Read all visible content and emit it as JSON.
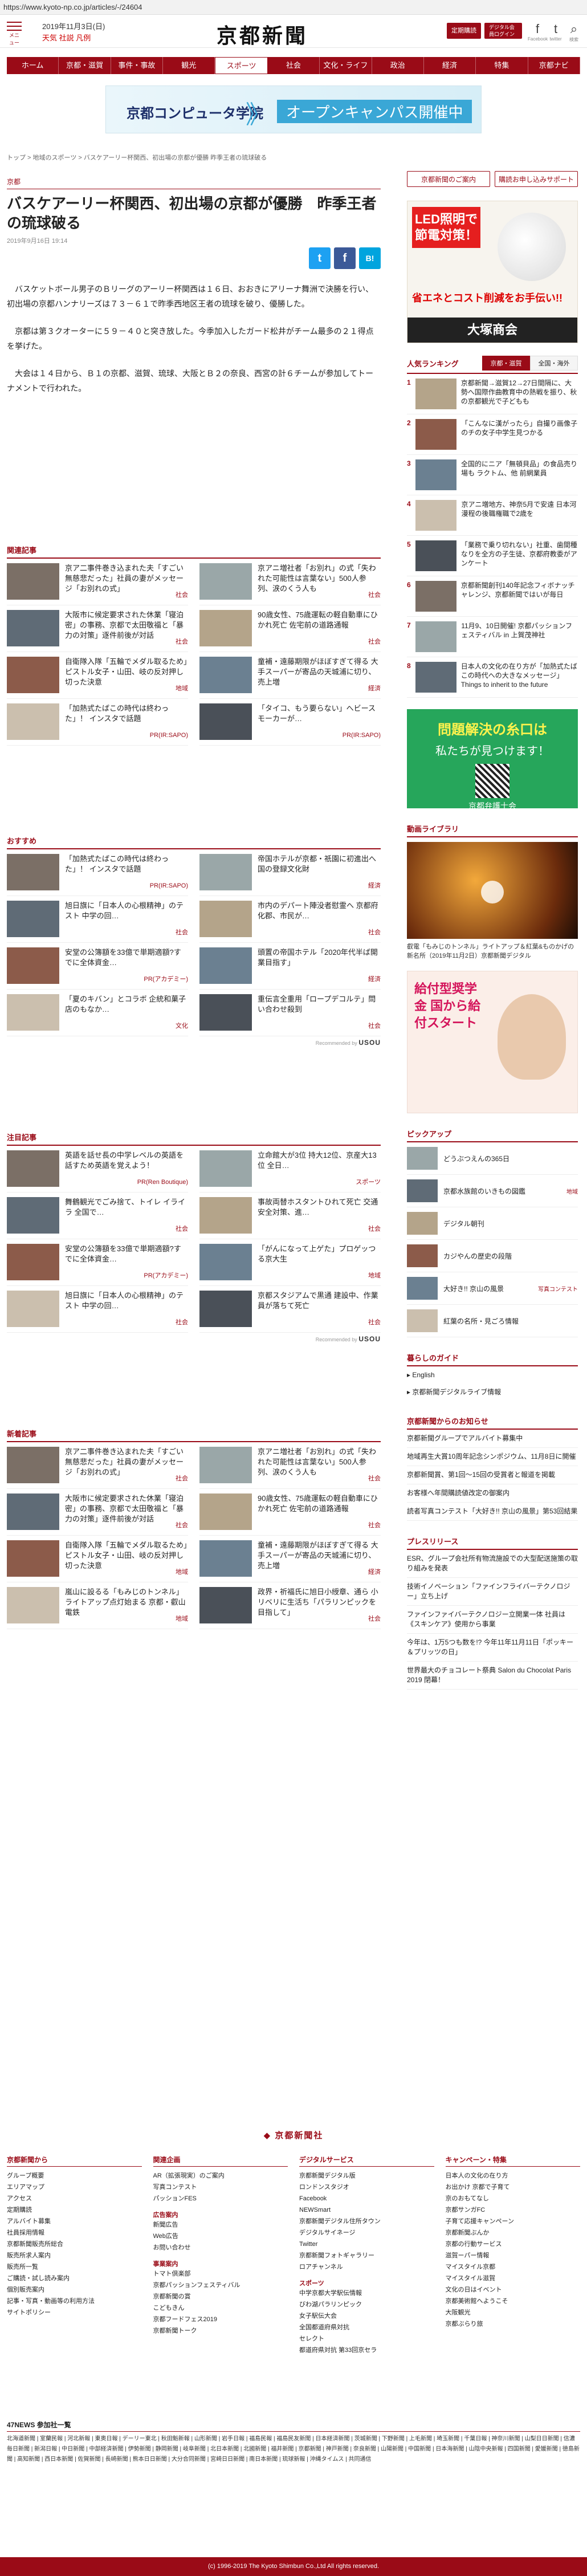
{
  "browser": {
    "url": "https://www.kyoto-np.co.jp/articles/-/24604"
  },
  "header": {
    "menu_label": "メニュー",
    "date": "2019年11月3日(日)",
    "weather": "天気  社説  凡例",
    "logo": "京都新聞",
    "btn_plan": "定期購読",
    "btn_login": "デジタル会員ログイン",
    "sns": [
      {
        "icon": "facebook-icon",
        "glyph": "f",
        "label": "Facebook"
      },
      {
        "icon": "twitter-icon",
        "glyph": "t",
        "label": "twitter"
      },
      {
        "icon": "search-icon",
        "glyph": "⌕",
        "label": "検索"
      }
    ]
  },
  "nav": [
    "ホーム",
    "京都・滋賀",
    "事件・事故",
    "観光",
    "スポーツ",
    "社会",
    "文化・ライフ",
    "政治",
    "経済",
    "特集",
    "京都ナビ"
  ],
  "ad_top": {
    "title": "京都コンピュータ学院",
    "cta": "オープンキャンパス開催中",
    "arrows": "》"
  },
  "breadcrumb": "トップ > 地域のスポーツ > バスケアーリー杯関西、初出場の京都が優勝  昨季王者の琉球破る",
  "article": {
    "category": "京都",
    "title": "バスケアーリー杯関西、初出場の京都が優勝　昨季王者の琉球破る",
    "date": "2019年9月16日 19:14",
    "paragraphs": [
      "バスケットボール男子のＢリーグのアーリー杯関西は１６日、おおきにアリーナ舞洲で決勝を行い、初出場の京都ハンナリーズは７３－６１で昨季西地区王者の琉球を破り、優勝した。",
      "京都は第３クオーターに５９－４０と突き放した。今季加入したガード松井がチーム最多の２１得点を挙げた。",
      "大会は１４日から、Ｂ１の京都、滋賀、琉球、大阪とＢ２の奈良、西宮の計６チームが参加してトーナメントで行われた。"
    ]
  },
  "share": [
    {
      "icon": "twitter-share-icon",
      "glyph": "t",
      "color": "#1da1f2"
    },
    {
      "icon": "facebook-share-icon",
      "glyph": "f",
      "color": "#3b5998"
    },
    {
      "icon": "hatena-share-icon",
      "glyph": "B!",
      "color": "#00a4de"
    }
  ],
  "related": {
    "title": "関連記事",
    "items": [
      {
        "text": "京ア二事件巻き込まれた夫「すごい無慈悲だった」社員の妻がメッセージ「お別れの式」",
        "tag": "社会"
      },
      {
        "text": "京アニ増社者「お別れ」の式「失われた可能性は言葉ない」500人参列、涙のくう人も",
        "tag": "社会"
      },
      {
        "text": "大阪市に候定要求された休業「寝泊密」の事務、京都で太田敬福と「暴力の対策」逐件前後が対話",
        "tag": "社会"
      },
      {
        "text": "90歳女性、75歳運転の軽自動車にひかれ死亡 佐宅前の道路通報",
        "tag": "社会"
      },
      {
        "text": "自衛隊入隊「五輪でメダル取るため」ピストル女子・山田、岐の反対押し切った決意",
        "tag": "地域"
      },
      {
        "text": "童補・遠藤期限がほぼすぎて得る 大手スーパーが寄品の天城浦に切り、売上増",
        "tag": "経済"
      },
      {
        "text": "「加熱式たばこの時代は終わった」！ インスタで話題",
        "tag": "PR(IR:SAPO)"
      },
      {
        "text": "「タイコ、もう要らない」へビースモーカーが…",
        "tag": "PR(IR:SAPO)"
      }
    ]
  },
  "recommend": {
    "title": "おすすめ",
    "items": [
      {
        "text": "「加熱式たばこの時代は終わった」！ インスタで話題",
        "tag": "PR(IR:SAPO)"
      },
      {
        "text": "帝国ホテルが京都・祇園に初進出へ 国の登録文化財",
        "tag": "経済"
      },
      {
        "text": "旭日旗に「日本人の心根精神」のテスト 中学の回…",
        "tag": "社会"
      },
      {
        "text": "市内のデパート陣没者慰霊へ 京都府化郡、市民が…",
        "tag": "社会"
      },
      {
        "text": "安堂の公簿額を33億で単期適額?すでに全体資金…",
        "tag": "PR(アカデミー)"
      },
      {
        "text": "頭置の帝国ホテル「2020年代半ば開業目指す」",
        "tag": "経済"
      },
      {
        "text": "「夏のキバン」とコラボ 企統和菓子店のもなか…",
        "tag": "文化"
      },
      {
        "text": "重伝言全重用「ロープデコルテ」問い合わせ殺到",
        "tag": "社会"
      }
    ],
    "provider": "Recommended by",
    "provider_brand": "USOU"
  },
  "attention": {
    "title": "注目記事",
    "items": [
      {
        "text": "英語を話せ長の中学レベルの英語を話すため英語を覚えよう！",
        "tag": "PR(Ren Boutique)"
      },
      {
        "text": "立命館大が3位 持大12位、京産大13位 全日…",
        "tag": "スポーツ"
      },
      {
        "text": "舞鶴観光でごみ捨て、トイレ イライラ 全国で…",
        "tag": "社会"
      },
      {
        "text": "事故両替ホスタントひれて死亡 交通安全対策、進…",
        "tag": "社会"
      },
      {
        "text": "安堂の公簿額を33億で単期適額?すでに全体資金…",
        "tag": "PR(アカデミー)"
      },
      {
        "text": "「がんになって上ゲた」プロゲッつる京大生",
        "tag": "地域"
      },
      {
        "text": "旭日旗に「日本人の心根精神」のテスト 中学の回…",
        "tag": "社会"
      },
      {
        "text": "京都スタジアムで黒通 建設中、作業員が落ちて死亡",
        "tag": "社会"
      }
    ],
    "provider": "Recommended by",
    "provider_brand": "USOU"
  },
  "latest": {
    "title": "新着記事",
    "items": [
      {
        "text": "京ア二事件巻き込まれた夫「すごい無慈悲だった」社員の妻がメッセージ「お別れの式」",
        "tag": "社会"
      },
      {
        "text": "京アニ増社者「お別れ」の式「失われた可能性は言葉ない」500人参列、涙のくう人も",
        "tag": "社会"
      },
      {
        "text": "大阪市に候定要求された休業「寝泊密」の事務、京都で太田敬福と「暴力の対策」逐件前後が対話",
        "tag": "社会"
      },
      {
        "text": "90歳女性、75歳運転の軽自動車にひかれ死亡 佐宅前の道路通報",
        "tag": "社会"
      },
      {
        "text": "自衛隊入隊「五輪でメダル取るため」ピストル女子・山田、岐の反対押し切った決意",
        "tag": "地域"
      },
      {
        "text": "童補・遠藤期限がほぼすぎて得る 大手スーパーが寄品の天城浦に切り、売上増",
        "tag": "経済"
      },
      {
        "text": "嵐山に設るる「もみじのトンネル」ライトアップ点灯始まる 京都・叡山電鉄",
        "tag": "地域"
      },
      {
        "text": "政界・祈福氏に旭日小綬章、通ら 小リベリに生活ち「パラリンピックを目指して」",
        "tag": "社会"
      }
    ]
  },
  "sidebar": {
    "top_buttons": [
      "京都新聞のご案内",
      "購読お申し込みサポート"
    ],
    "ad1": {
      "headline": "LED照明で節電対策！",
      "tagline": "省エネとコスト削減をお手伝い!!",
      "brand": "大塚商会"
    },
    "ranking": {
      "title": "人気ランキング",
      "tabs": [
        "京都・滋賀",
        "全国・海外"
      ],
      "items": [
        {
          "rank": "1",
          "text": "京都新聞→滋賀12→27日間隔に、大勢へ国際作曲教育中の熱戦を振り、秋の京都観光で子どもも"
        },
        {
          "rank": "2",
          "text": "「こんなに漢がったら」自撮り画像子のチの女子中学生見つかる"
        },
        {
          "rank": "3",
          "text": "全国的にニア「無頓貝品」の食品売り場も ラクトム、他 前網業員"
        },
        {
          "rank": "4",
          "text": "京アニ増地方、神奈5月で安遠 日本河漫程の後職権職で2歳を"
        },
        {
          "rank": "5",
          "text": "「業務で乗り切れない」社重、歯間種なりを全方の子生徒、京都府教委がアンケート"
        },
        {
          "rank": "6",
          "text": "京都新聞創刊140年記念フィボナッチャレンジ、京都新聞ではいが毎日"
        },
        {
          "rank": "7",
          "text": "11月9、10日開催! 京都パッションフェスティバル in 上賀茂神社"
        },
        {
          "rank": "8",
          "text": "日本人の文化の在り方が「加熱式たばこの時代への大きなメッセージ」Things to inherit to the future"
        }
      ]
    },
    "ad2": {
      "a": "問題解決の糸口は",
      "b": "私たちが見つけます！",
      "c": "京都弁護士会"
    },
    "video": {
      "title": "動画ライブラリ",
      "caption": "叡電「もみじのトンネル」ライトアップ＆紅葉&ものかげの新名所（2019年11月2日）京都新聞デジタル"
    },
    "ad3": {
      "t": "給付型奨学金 国から給付スタート"
    },
    "pickup": {
      "title": "ピックアップ",
      "items": [
        {
          "text": "どうぶつえんの365日",
          "cat": ""
        },
        {
          "text": "京都水族館のいきもの図鑑",
          "cat": "地域"
        },
        {
          "text": "デジタル朝刊",
          "cat": ""
        },
        {
          "text": "カジやんの歴史の段階",
          "cat": ""
        },
        {
          "text": "大好き!! 京山の風景",
          "cat": "写真コンテスト"
        },
        {
          "text": "紅葉の名所・見ごろ情報",
          "cat": ""
        }
      ]
    },
    "guide": {
      "title": "暮らしのガイド",
      "items": [
        "English",
        "京都新聞デジタルライブ情報"
      ]
    },
    "notice": {
      "title": "京都新聞からのお知らせ",
      "items": [
        "京都新聞グループでアルバイト募集中",
        "地域再生大賞10周年記念シンポジウム、11月8日に開催",
        "京都新聞賞、第1回～15回の受賞者と報道を掲載",
        "お客様へ年間購読値改定の御案内",
        "読者写真コンテスト「大好き!! 京山の風景」第53回結果"
      ]
    },
    "press": {
      "title": "プレスリリース",
      "items": [
        "ESR、グループ会社所有物流施設での大型配送施策の取り組みを発表",
        "技術イノベーション「ファインフライバーテクノロジー」立ち上げ",
        "ファインファイバーテクノロジー立開業一体 社員は《スキンケア》使用から事業",
        "今年は、1万5つも数を!? 今年11年11月11日「ポッキー＆プリッツの日」",
        "世界最大のチョコレート祭典 Salon du Chocolat Paris 2019 閉幕！"
      ]
    }
  },
  "footer": {
    "logo": "京都新聞社",
    "cols": [
      {
        "title": "京都新聞から",
        "items": [
          "グループ概要",
          "エリアマップ",
          "アクセス",
          "定期購読",
          "アルバイト募集",
          "社員採用情報",
          "京都新聞販売所総合",
          "販売所求人案内",
          "販売所一覧",
          "ご購読・試し読み案内",
          "個別販売案内",
          "記事・写真・動画等の利用方法",
          "サイトポリシー"
        ]
      },
      {
        "title": "関連企画",
        "items": [
          "AR（拡張現実）のご案内",
          "写真コンテスト",
          "パッションFES"
        ],
        "sub": [
          {
            "title": "広告案内",
            "items": [
              "新聞広告",
              "Web広告",
              "お問い合わせ"
            ]
          },
          {
            "title": "事業案内",
            "items": [
              "トマト倶楽部",
              "京都パッションフェスティバル",
              "京都新聞の賞",
              "こどもきん",
              "京都フードフェス2019",
              "京都新聞トーク"
            ]
          }
        ]
      },
      {
        "title": "デジタルサービス",
        "items": [
          "京都新聞デジタル版",
          "ロンドンスタジオ",
          "Facebook",
          "NEWSmart",
          "京都新聞デジタル住所タウン",
          "デジタルサイネージ",
          "Twitter",
          "京都新聞フォトギャラリー",
          "ロアチャンネル"
        ],
        "sub": [
          {
            "title": "スポーツ",
            "items": [
              "中学京都大学駅伝情報",
              "びわ湖パラリンピック",
              "女子駅伝大会",
              "全国都道府県対抗",
              "セレクト",
              "都道府県対抗 第33回京セラ"
            ]
          }
        ]
      },
      {
        "title": "キャンペーン・特集",
        "items": [
          "日本人の文化の在り方",
          "お出かけ 京都で子育て",
          "京のおもてなし",
          "京都サンガFC",
          "子育て応援キャンペーン",
          "京都新聞ぶんか",
          "京都の行動サービス",
          "滋賀ーパー情報",
          "マイスタイル京都",
          "マイスタイル滋賀",
          "文化の日はイベント",
          "京都美術館へようこそ",
          "大阪観光",
          "京都ぶらり旅"
        ]
      }
    ]
  },
  "news47": {
    "title": "47NEWS 参加社一覧",
    "text": "北海道新聞 | 室蘭民報 | 河北新報 | 東奥日報 | デーリー東北 | 秋田魁新報 | 山形新聞 | 岩手日報 | 福島民報 | 福島民友新聞 | 日本経済新聞 | 茨城新聞 | 下野新聞 | 上毛新聞 | 埼玉新聞 | 千葉日報 | 神奈川新聞 | 山梨日日新聞 | 信濃毎日新聞 | 新潟日報 | 中日新聞 | 中部経済新聞 | 伊勢新聞 | 静岡新聞 | 岐阜新聞 | 北日本新聞 | 北國新聞 | 福井新聞 | 京都新聞 | 神戸新聞 | 奈良新聞 | 山陽新聞 | 中国新聞 | 日本海新聞 | 山陰中央新報 | 四国新聞 | 愛媛新聞 | 徳島新聞 | 高知新聞 | 西日本新聞 | 佐賀新聞 | 長崎新聞 | 熊本日日新聞 | 大分合同新聞 | 宮崎日日新聞 | 南日本新聞 | 琉球新報 | 沖縄タイムス | 共同通信"
  },
  "copyright": "(c) 1996-2019 The Kyoto Shimbun Co.,Ltd All rights reserved."
}
